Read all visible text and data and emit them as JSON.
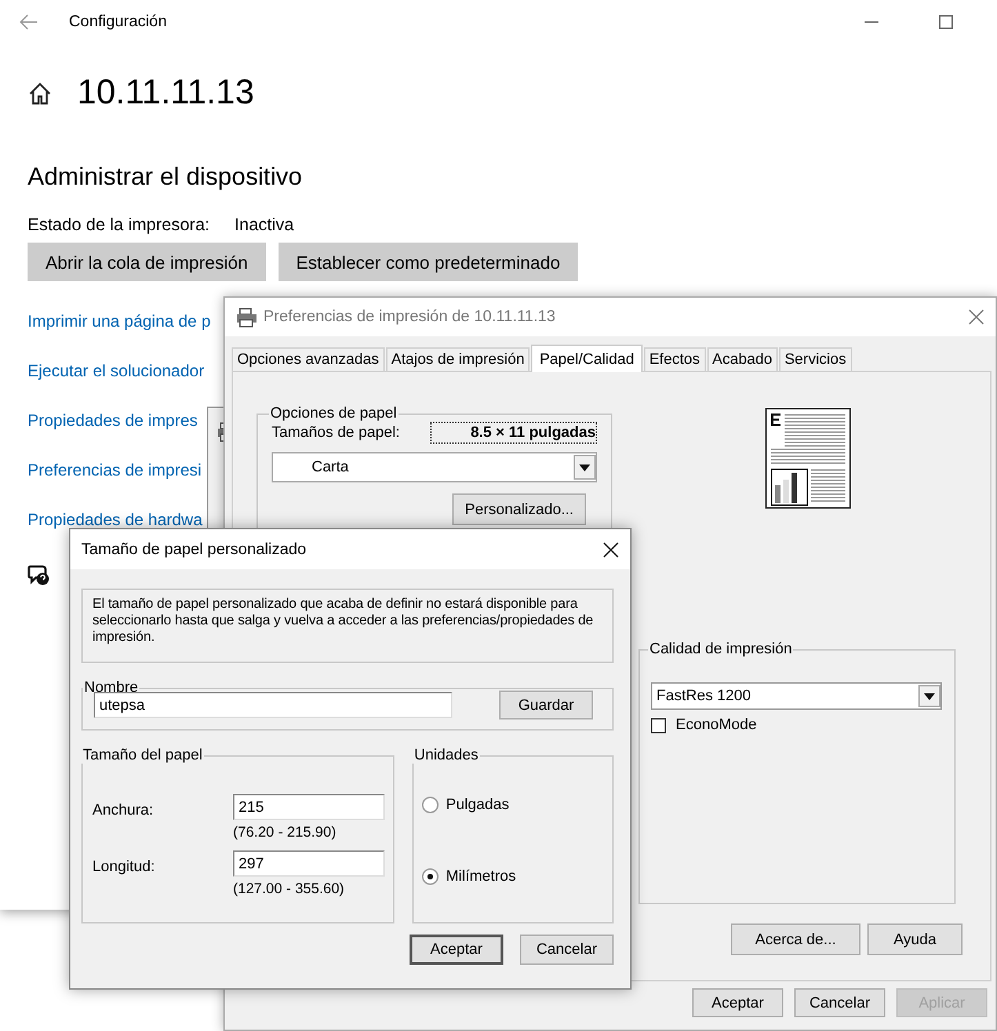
{
  "settings_window": {
    "title": "Configuración",
    "heading": "10.11.11.13",
    "section_title": "Administrar el dispositivo",
    "status_label": "Estado de la impresora:",
    "status_value": "Inactiva",
    "buttons": [
      "Abrir la cola de impresión",
      "Establecer como predeterminado"
    ],
    "links": [
      "Imprimir una página de p",
      "Ejecutar el solucionador",
      "Propiedades de impres",
      "Preferencias de impresi",
      "Propiedades de hardwa"
    ]
  },
  "preferences_window": {
    "title": "Preferencias de impresión de 10.11.11.13",
    "tabs": [
      {
        "label": "Opciones avanzadas",
        "selected": false
      },
      {
        "label": "Atajos de impresión",
        "selected": false
      },
      {
        "label": "Papel/Calidad",
        "selected": true
      },
      {
        "label": "Efectos",
        "selected": false
      },
      {
        "label": "Acabado",
        "selected": false
      },
      {
        "label": "Servicios",
        "selected": false
      }
    ],
    "paper_options": {
      "legend": "Opciones de papel",
      "size_label": "Tamaños de papel:",
      "size_value": "8.5 × 11 pulgadas",
      "size_select": "Carta",
      "custom_button": "Personalizado..."
    },
    "print_quality": {
      "legend": "Calidad de impresión",
      "select": "FastRes 1200",
      "econo_mode": {
        "label": "EconoMode",
        "checked": false
      }
    },
    "buttons": [
      "Acerca de...",
      "Ayuda"
    ],
    "footer_buttons": [
      {
        "label": "Aceptar",
        "disabled": false
      },
      {
        "label": "Cancelar",
        "disabled": false
      },
      {
        "label": "Aplicar",
        "disabled": true
      }
    ]
  },
  "custom_size_dialog": {
    "title": "Tamaño de papel personalizado",
    "notice": "El tamaño de papel personalizado que acaba de definir no estará disponible para seleccionarlo hasta que salga y vuelva a acceder a las preferencias/propiedades de impresión.",
    "name": {
      "legend": "Nombre",
      "value": "utepsa",
      "button": "Guardar"
    },
    "size": {
      "legend": "Tamaño del papel",
      "fields": [
        {
          "label": "Anchura:",
          "value": "215",
          "range": "(76.20 - 215.90)"
        },
        {
          "label": "Longitud:",
          "value": "297",
          "range": "(127.00 - 355.60)"
        }
      ]
    },
    "units": {
      "legend": "Unidades",
      "options": [
        {
          "label": "Pulgadas",
          "selected": false
        },
        {
          "label": "Milímetros",
          "selected": true
        }
      ]
    },
    "buttons": [
      {
        "label": "Aceptar",
        "default": true
      },
      {
        "label": "Cancelar",
        "default": false
      }
    ]
  }
}
